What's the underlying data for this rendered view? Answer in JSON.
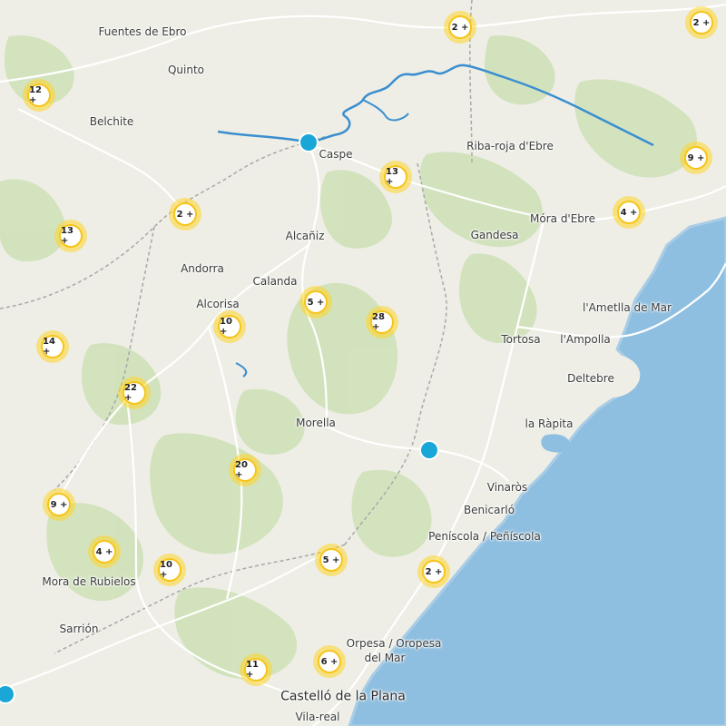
{
  "colors": {
    "land": "#eeeee6",
    "sea": "#8fbfe0",
    "coast": "#aacde6",
    "forest": "#cfe1b9",
    "road": "#ffffff",
    "river": "#3a8ed0",
    "border": "#a8a8a8",
    "cluster_ring": "#f6c51b",
    "marker": "#1aa7d8"
  },
  "places": [
    {
      "name": "Fuentes de Ebro"
    },
    {
      "name": "Quinto"
    },
    {
      "name": "Belchite"
    },
    {
      "name": "Caspe"
    },
    {
      "name": "Riba-roja d'Ebre"
    },
    {
      "name": "Móra d'Ebre"
    },
    {
      "name": "Gandesa"
    },
    {
      "name": "Alcañiz"
    },
    {
      "name": "Andorra"
    },
    {
      "name": "Calanda"
    },
    {
      "name": "Alcorisa"
    },
    {
      "name": "l'Ametlla de Mar"
    },
    {
      "name": "Tortosa"
    },
    {
      "name": "l'Ampolla"
    },
    {
      "name": "Deltebre"
    },
    {
      "name": "Morella"
    },
    {
      "name": "la Ràpita"
    },
    {
      "name": "Vinaròs"
    },
    {
      "name": "Benicarló"
    },
    {
      "name": "Peníscola / Peñíscola"
    },
    {
      "name": "Mora de Rubielos"
    },
    {
      "name": "Sarrión"
    },
    {
      "name": "Orpesa / Oropesa"
    },
    {
      "name": "del Mar"
    },
    {
      "name": "Castelló de la Plana"
    },
    {
      "name": "Vila-real"
    }
  ],
  "clusters": [
    {
      "label": "2 +"
    },
    {
      "label": "2 +"
    },
    {
      "label": "12 +"
    },
    {
      "label": "9 +"
    },
    {
      "label": "13 +"
    },
    {
      "label": "2 +"
    },
    {
      "label": "4 +"
    },
    {
      "label": "13 +"
    },
    {
      "label": "5 +"
    },
    {
      "label": "28 +"
    },
    {
      "label": "10 +"
    },
    {
      "label": "14 +"
    },
    {
      "label": "22 +"
    },
    {
      "label": "20 +"
    },
    {
      "label": "9 +"
    },
    {
      "label": "4 +"
    },
    {
      "label": "10 +"
    },
    {
      "label": "5 +"
    },
    {
      "label": "2 +"
    },
    {
      "label": "11 +"
    },
    {
      "label": "6 +"
    }
  ],
  "markers": [
    {
      "name": "marker-caspe"
    },
    {
      "name": "marker-morella-east"
    },
    {
      "name": "marker-southwest"
    }
  ]
}
